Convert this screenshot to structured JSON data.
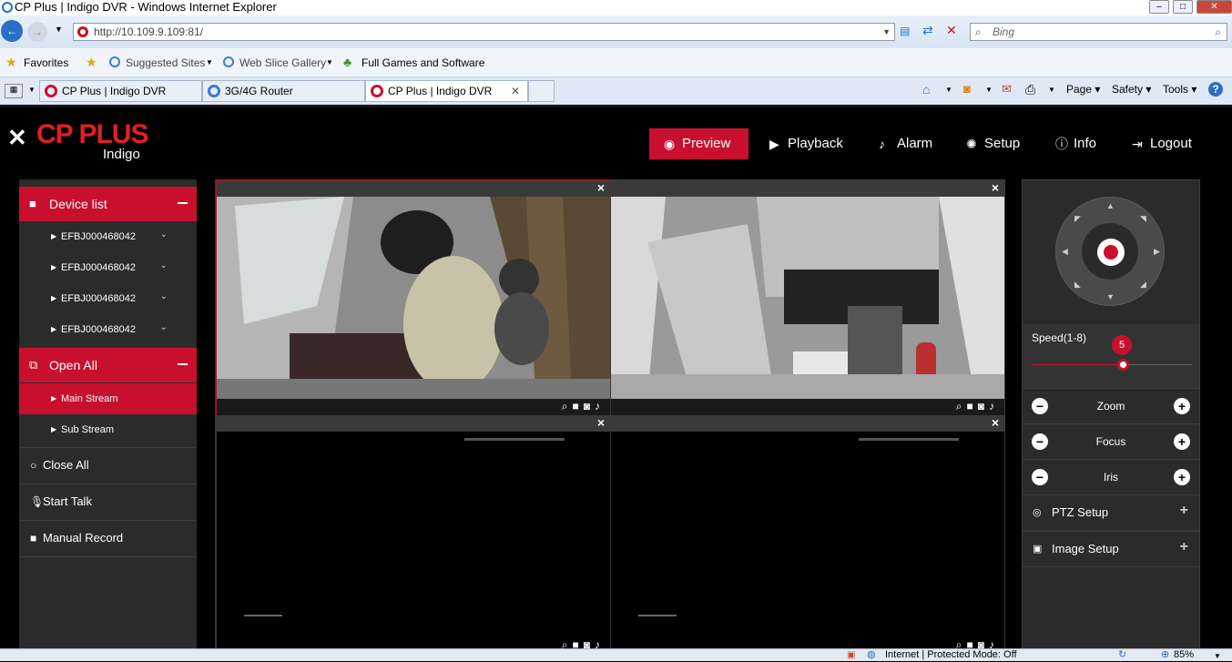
{
  "browser": {
    "title": "CP Plus | Indigo DVR - Windows Internet Explorer",
    "url": "http://10.109.9.109:81/",
    "search_placeholder": "Bing",
    "favorites": {
      "label": "Favorites",
      "items": [
        "Suggested Sites",
        "Web Slice Gallery",
        "Full Games and Software"
      ]
    },
    "tabs": [
      "CP Plus | Indigo DVR",
      "3G/4G Router",
      "CP Plus | Indigo DVR"
    ],
    "commands": [
      "Page",
      "Safety",
      "Tools"
    ],
    "status": "Internet | Protected Mode: Off",
    "zoom": "85%"
  },
  "app": {
    "logo": "CP PLUS",
    "logo_sub": "Indigo",
    "nav": [
      "Preview",
      "Playback",
      "Alarm",
      "Setup",
      "Info",
      "Logout"
    ],
    "left": {
      "device_list": "Device list",
      "devices": [
        "EFBJ000468042",
        "EFBJ000468042",
        "EFBJ000468042",
        "EFBJ000468042"
      ],
      "open_all": "Open All",
      "streams": [
        "Main Stream",
        "Sub Stream"
      ],
      "close_all": "Close All",
      "start_talk": "Start Talk",
      "manual_record": "Manual Record"
    },
    "right": {
      "speed_label": "Speed(1-8)",
      "speed_value": "5",
      "speed_fraction": 0.57,
      "zoom": "Zoom",
      "focus": "Focus",
      "iris": "Iris",
      "ptz_setup": "PTZ Setup",
      "image_setup": "Image Setup"
    }
  }
}
